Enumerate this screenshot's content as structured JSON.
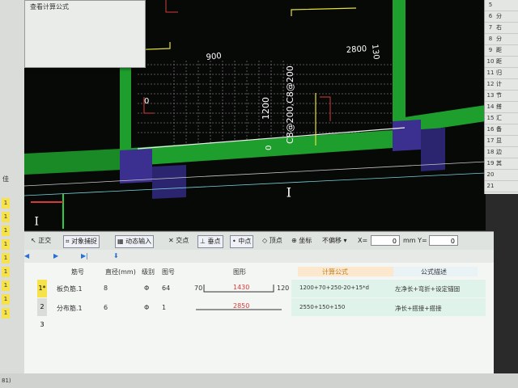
{
  "floating_panel": {
    "title": "查看计算公式"
  },
  "viewport": {
    "labels": {
      "dim_900": "900",
      "dim_2800": "2800",
      "dim_130": "130",
      "dim_1200": "1200",
      "spec": "C8@200,C8@200",
      "zero_a": "0",
      "zero_b": "0",
      "axis_i_1": "I",
      "axis_i_2": "I"
    },
    "colors": {
      "bg": "#070907",
      "green": "#1e9e2c",
      "blue": "#3b2f8f",
      "grid": "#9a9a9a"
    }
  },
  "right_panel": {
    "rows": [
      {
        "num": "5",
        "txt": ""
      },
      {
        "num": "6",
        "txt": "分"
      },
      {
        "num": "7",
        "txt": "右"
      },
      {
        "num": "8",
        "txt": "分"
      },
      {
        "num": "9",
        "txt": "距"
      },
      {
        "num": "10",
        "txt": "距"
      },
      {
        "num": "11",
        "txt": "归"
      },
      {
        "num": "12",
        "txt": "计"
      },
      {
        "num": "13",
        "txt": "节"
      },
      {
        "num": "14",
        "txt": "搭"
      },
      {
        "num": "15",
        "txt": "汇"
      },
      {
        "num": "16",
        "txt": "备"
      },
      {
        "num": "17",
        "txt": "显"
      },
      {
        "num": "18",
        "txt": "边"
      },
      {
        "num": "19",
        "txt": "其"
      },
      {
        "num": "20",
        "txt": ""
      },
      {
        "num": "21",
        "txt": ""
      }
    ]
  },
  "left_strip": {
    "cells": [
      "1",
      "1",
      "1",
      "1",
      "1",
      "1",
      "1",
      "1",
      "1",
      "1",
      "1"
    ],
    "label": "佳"
  },
  "toolbar": {
    "ortho": "正交",
    "snap": "对象捕捉",
    "dyn": "动态输入",
    "intersect": "交点",
    "perp": "垂点",
    "mid": "中点",
    "apex": "顶点",
    "coord": "坐标",
    "nooffset": "不偏移",
    "x_label": "X=",
    "x_val": "0",
    "mm_y": "mm Y=",
    "y_val": "0"
  },
  "table": {
    "headers": [
      "筋号",
      "直径(mm)",
      "级别",
      "图号",
      "图形",
      "计算公式",
      "公式描述"
    ],
    "rows": [
      {
        "n": "1*",
        "name": "板负筋.1",
        "dia": "8",
        "grade": "Φ",
        "fig": "64",
        "left": "70",
        "mid": "1430",
        "right": "120",
        "formula": "1200+70+250-20+15*d",
        "desc": "左净长+弯折+设定锚固"
      },
      {
        "n": "2",
        "name": "分布筋.1",
        "dia": "6",
        "grade": "Φ",
        "fig": "1",
        "left": "",
        "mid": "2850",
        "right": "",
        "formula": "2550+150+150",
        "desc": "净长+搭接+搭接"
      },
      {
        "n": "3",
        "name": "",
        "dia": "",
        "grade": "",
        "fig": "",
        "left": "",
        "mid": "",
        "right": "",
        "formula": "",
        "desc": ""
      }
    ]
  },
  "status": {
    "text": "81)"
  }
}
